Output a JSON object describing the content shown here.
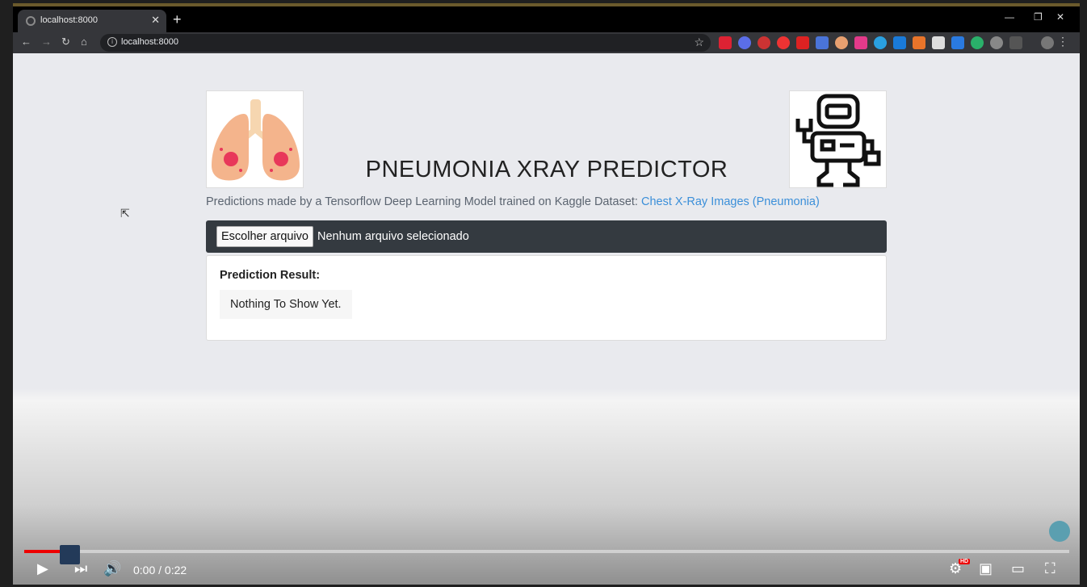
{
  "browser": {
    "tab_title": "localhost:8000",
    "url": "localhost:8000"
  },
  "page": {
    "title": "PNEUMONIA XRAY PREDICTOR",
    "subtitle_text": "Predictions made by a Tensorflow Deep Learning Model trained on Kaggle Dataset: ",
    "subtitle_link": "Chest X-Ray Images (Pneumonia)",
    "file_button_label": "Escolher arquivo",
    "file_status": "Nenhum arquivo selecionado",
    "result_heading": "Prediction Result:",
    "result_value": "Nothing To Show Yet."
  },
  "player": {
    "time_display": "0:00 / 0:22",
    "hd_badge": "HD",
    "progress_fraction": 0.035
  },
  "colors": {
    "upload_bar": "#343a40",
    "link": "#3b8fd9",
    "progress": "#ee0000"
  },
  "icons": [
    "lungs-icon",
    "robot-icon",
    "play-icon",
    "next-icon",
    "volume-icon",
    "settings-icon",
    "miniplayer-icon",
    "theater-icon",
    "fullscreen-icon"
  ]
}
